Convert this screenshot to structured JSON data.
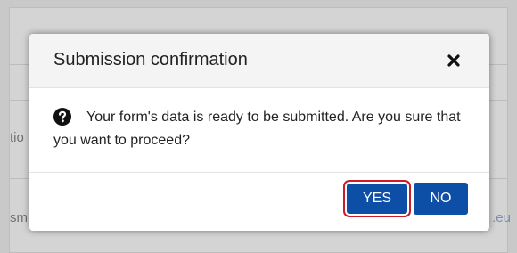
{
  "background": {
    "left_fragments": [
      "tio",
      "smi"
    ],
    "right_fragments": [
      ".eu"
    ]
  },
  "dialog": {
    "title": "Submission confirmation",
    "close_icon": "close-icon",
    "question_icon": "question-circle-icon",
    "message": "Your form's data is ready to be submitted. Are you sure that you want to proceed?",
    "buttons": {
      "yes": "YES",
      "no": "NO"
    }
  },
  "colors": {
    "primary_button": "#0d4ea6",
    "focus_outline": "#cc1b2a",
    "header_background": "#f4f4f4",
    "overlay": "#c9c9c9"
  }
}
